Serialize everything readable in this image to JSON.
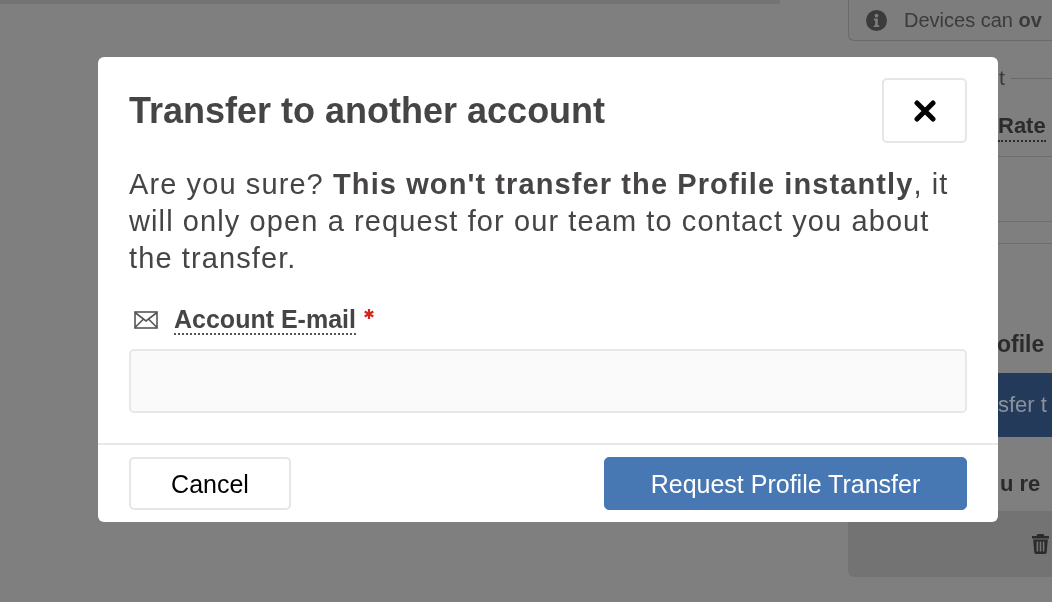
{
  "background": {
    "notice": "Devices can **ov**",
    "section_title": "t",
    "field_label": "Rate",
    "heading": "ofile",
    "button": "sfer t",
    "text": "u re"
  },
  "dialog": {
    "title": "Transfer to another account",
    "message": "Are you sure? **This won't transfer the Profile instantly**, it will only open a request for our team to contact you about the transfer.",
    "field": {
      "label": "Account E-mail",
      "required": true
    },
    "buttons": [
      {
        "label": "Cancel",
        "kind": "secondary"
      },
      {
        "label": "Request Profile Transfer",
        "kind": "primary"
      }
    ]
  }
}
